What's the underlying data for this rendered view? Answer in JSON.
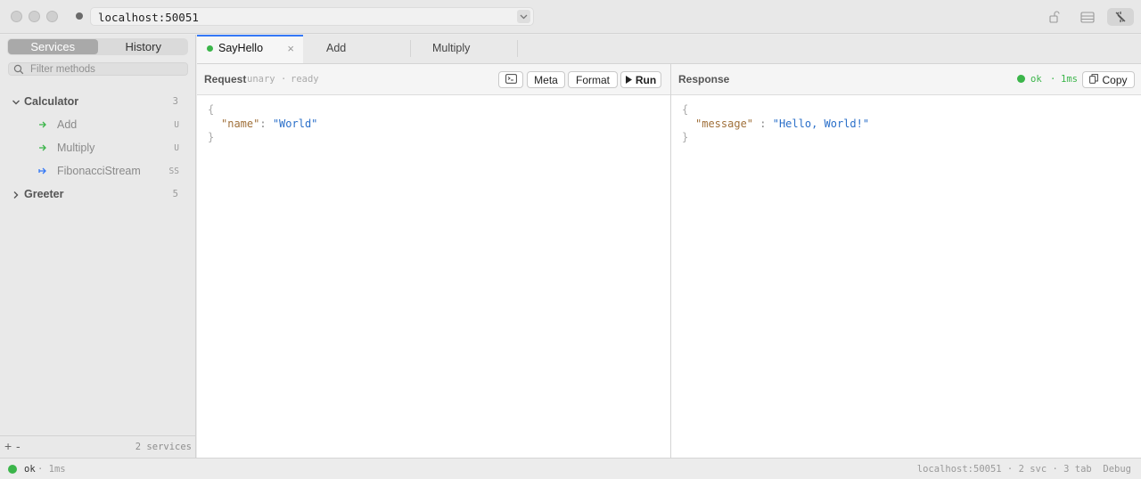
{
  "titlebar": {
    "address": "localhost:50051"
  },
  "sidebar": {
    "segments": [
      "Services",
      "History"
    ],
    "selected_segment": "Services",
    "filter_placeholder": "Filter methods",
    "services": [
      {
        "name": "Calculator",
        "count": "3",
        "expanded": true,
        "methods": [
          {
            "name": "Add",
            "kind": "U",
            "icon": "unary-arrow-icon"
          },
          {
            "name": "Multiply",
            "kind": "U",
            "icon": "unary-arrow-icon"
          },
          {
            "name": "FibonacciStream",
            "kind": "SS",
            "icon": "stream-arrow-icon"
          }
        ]
      },
      {
        "name": "Greeter",
        "count": "5",
        "expanded": false,
        "methods": []
      }
    ],
    "footer": {
      "add_label": "+",
      "remove_label": "-",
      "service_count": "2 services"
    }
  },
  "tabs": [
    {
      "label": "SayHello",
      "active": true,
      "status": "ok",
      "close": "×"
    },
    {
      "label": "Add",
      "active": false
    },
    {
      "label": "Multiply",
      "active": false
    }
  ],
  "request": {
    "title": "Request",
    "kind": "unary",
    "separator": "·",
    "state": "ready",
    "buttons": {
      "meta": "Meta",
      "format": "Format",
      "run": "Run"
    },
    "body": {
      "open": "{",
      "key": "\"name\"",
      "colon": ":",
      "value": "\"World\"",
      "close": "}"
    }
  },
  "response": {
    "title": "Response",
    "status": "ok",
    "separator": "·",
    "latency": "1ms",
    "copy_label": "Copy",
    "body": {
      "open": "{",
      "key": "\"message\"",
      "colon": ":",
      "value": "\"Hello, World!\"",
      "close": "}"
    }
  },
  "statusbar": {
    "status": "ok",
    "latency": "· 1ms",
    "right": "localhost:50051 · 2 svc · 3 tab  Debug"
  },
  "colors": {
    "ok_green": "#3bb54a",
    "accent_blue": "#3478f6",
    "json_key": "#a0703a",
    "json_string": "#2a6fc9"
  }
}
